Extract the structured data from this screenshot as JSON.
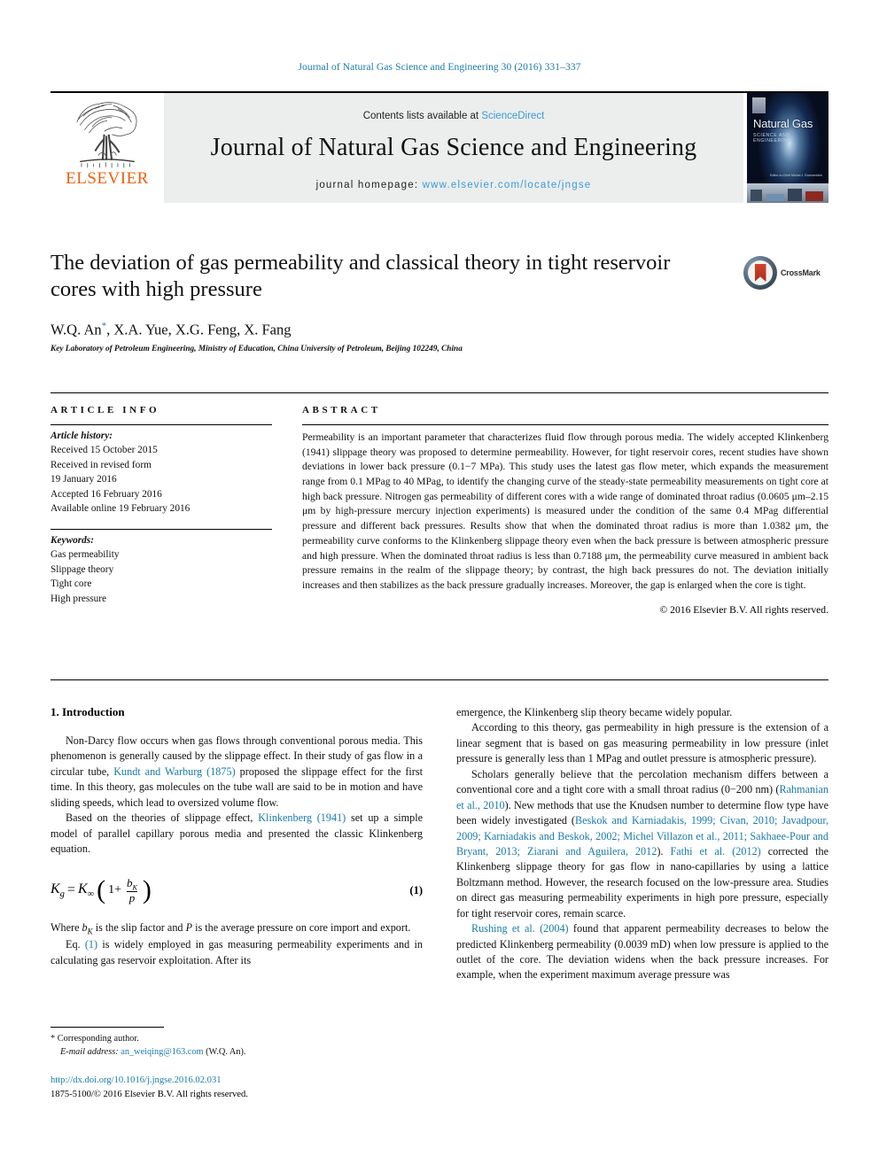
{
  "running_head": "Journal of Natural Gas Science and Engineering 30 (2016) 331–337",
  "masthead": {
    "publisher": "ELSEVIER",
    "contents_prefix": "Contents lists available at ",
    "contents_link": "ScienceDirect",
    "journal_title": "Journal of Natural Gas Science and Engineering",
    "homepage_prefix": "journal homepage: ",
    "homepage_url": "www.elsevier.com/locate/jngse",
    "cover": {
      "title": "Natural Gas",
      "subtitle": "SCIENCE AND ENGINEERING",
      "editors": "Editor-in-Chief\nMichel J. Economides"
    }
  },
  "article": {
    "title": "The deviation of gas permeability and classical theory in tight reservoir cores with high pressure",
    "authors": "W.Q. An",
    "authors_rest": ", X.A. Yue, X.G. Feng, X. Fang",
    "corresponding_mark": "*",
    "affiliation": "Key Laboratory of Petroleum Engineering, Ministry of Education, China University of Petroleum, Beijing 102249, China",
    "crossmark_label": "CrossMark"
  },
  "article_info": {
    "heading": "ARTICLE INFO",
    "history_label": "Article history:",
    "history": [
      "Received 15 October 2015",
      "Received in revised form",
      "19 January 2016",
      "Accepted 16 February 2016",
      "Available online 19 February 2016"
    ],
    "keywords_label": "Keywords:",
    "keywords": [
      "Gas permeability",
      "Slippage theory",
      "Tight core",
      "High pressure"
    ]
  },
  "abstract": {
    "heading": "ABSTRACT",
    "text": "Permeability is an important parameter that characterizes fluid flow through porous media. The widely accepted Klinkenberg (1941) slippage theory was proposed to determine permeability. However, for tight reservoir cores, recent studies have shown deviations in lower back pressure (0.1−7 MPa). This study uses the latest gas flow meter, which expands the measurement range from 0.1 MPag to 40 MPag, to identify the changing curve of the steady-state permeability measurements on tight core at high back pressure. Nitrogen gas permeability of different cores with a wide range of dominated throat radius (0.0605 μm–2.15 μm by high-pressure mercury injection experiments) is measured under the condition of the same 0.4 MPag differential pressure and different back pressures. Results show that when the dominated throat radius is more than 1.0382 μm, the permeability curve conforms to the Klinkenberg slippage theory even when the back pressure is between atmospheric pressure and high pressure. When the dominated throat radius is less than 0.7188 μm, the permeability curve measured in ambient back pressure remains in the realm of the slippage theory; by contrast, the high back pressures do not. The deviation initially increases and then stabilizes as the back pressure gradually increases. Moreover, the gap is enlarged when the core is tight.",
    "copyright": "© 2016 Elsevier B.V. All rights reserved."
  },
  "body": {
    "section_title": "1. Introduction",
    "left": {
      "p1_a": "Non-Darcy flow occurs when gas flows through conventional porous media. This phenomenon is generally caused by the slippage effect. In their study of gas flow in a circular tube, ",
      "p1_ref": "Kundt and Warburg (1875)",
      "p1_b": " proposed the slippage effect for the first time. In this theory, gas molecules on the tube wall are said to be in motion and have sliding speeds, which lead to oversized volume flow.",
      "p2_a": "Based on the theories of slippage effect, ",
      "p2_ref": "Klinkenberg (1941)",
      "p2_b": " set up a simple model of parallel capillary porous media and presented the classic Klinkenberg equation.",
      "equation": {
        "lhs": "K",
        "lhs_sub": "g",
        "eq": "=",
        "rhs": "K",
        "rhs_sub": "∞",
        "one_plus": "1+",
        "frac_num": "b",
        "frac_num_sub": "K",
        "frac_den": "p",
        "number": "(1)"
      },
      "p3_a": "Where ",
      "p3_sym1": "b",
      "p3_sym1_sub": "K",
      "p3_b": " is the slip factor and ",
      "p3_sym2": "P",
      "p3_c": " is the average pressure on core import and export.",
      "p4_a": "Eq. ",
      "p4_ref": "(1)",
      "p4_b": " is widely employed in gas measuring permeability experiments and in calculating gas reservoir exploitation. After its"
    },
    "right": {
      "p0": "emergence, the Klinkenberg slip theory became widely popular.",
      "p1": "According to this theory, gas permeability in high pressure is the extension of a linear segment that is based on gas measuring permeability in low pressure (inlet pressure is generally less than 1 MPag and outlet pressure is atmospheric pressure).",
      "p2_a": "Scholars generally believe that the percolation mechanism differs between a conventional core and a tight core with a small throat radius (0−200 nm) (",
      "p2_ref1": "Rahmanian et al., 2010",
      "p2_b": "). New methods that use the Knudsen number to determine flow type have been widely investigated (",
      "p2_ref2": "Beskok and Karniadakis, 1999; Civan, 2010; Javadpour, 2009; Karniadakis and Beskok, 2002; Michel Villazon et al., 2011; Sakhaee-Pour and Bryant, 2013; Ziarani and Aguilera, 2012",
      "p2_c": "). ",
      "p2_ref3": "Fathi et al. (2012)",
      "p2_d": " corrected the Klinkenberg slippage theory for gas flow in nano-capillaries by using a lattice Boltzmann method. However, the research focused on the low-pressure area. Studies on direct gas measuring permeability experiments in high pore pressure, especially for tight reservoir cores, remain scarce.",
      "p3_ref": "Rushing et al. (2004)",
      "p3_a": " found that apparent permeability decreases to below the predicted Klinkenberg permeability (0.0039 mD) when low pressure is applied to the outlet of the core. The deviation widens when the back pressure increases. For example, when the experiment maximum average pressure was"
    }
  },
  "footer": {
    "corresponding_mark": "*",
    "corresponding_label": "Corresponding author.",
    "email_label": "E-mail address:",
    "email": "an_weiqing@163.com",
    "email_owner": "(W.Q. An).",
    "doi": "http://dx.doi.org/10.1016/j.jngse.2016.02.031",
    "issn_line": "1875-5100/© 2016 Elsevier B.V. All rights reserved."
  },
  "colors": {
    "link": "#1a7aa8",
    "sciencedirect": "#3a9bd4",
    "elsevier_orange": "#e8610f",
    "band_gray": "#eceded"
  }
}
